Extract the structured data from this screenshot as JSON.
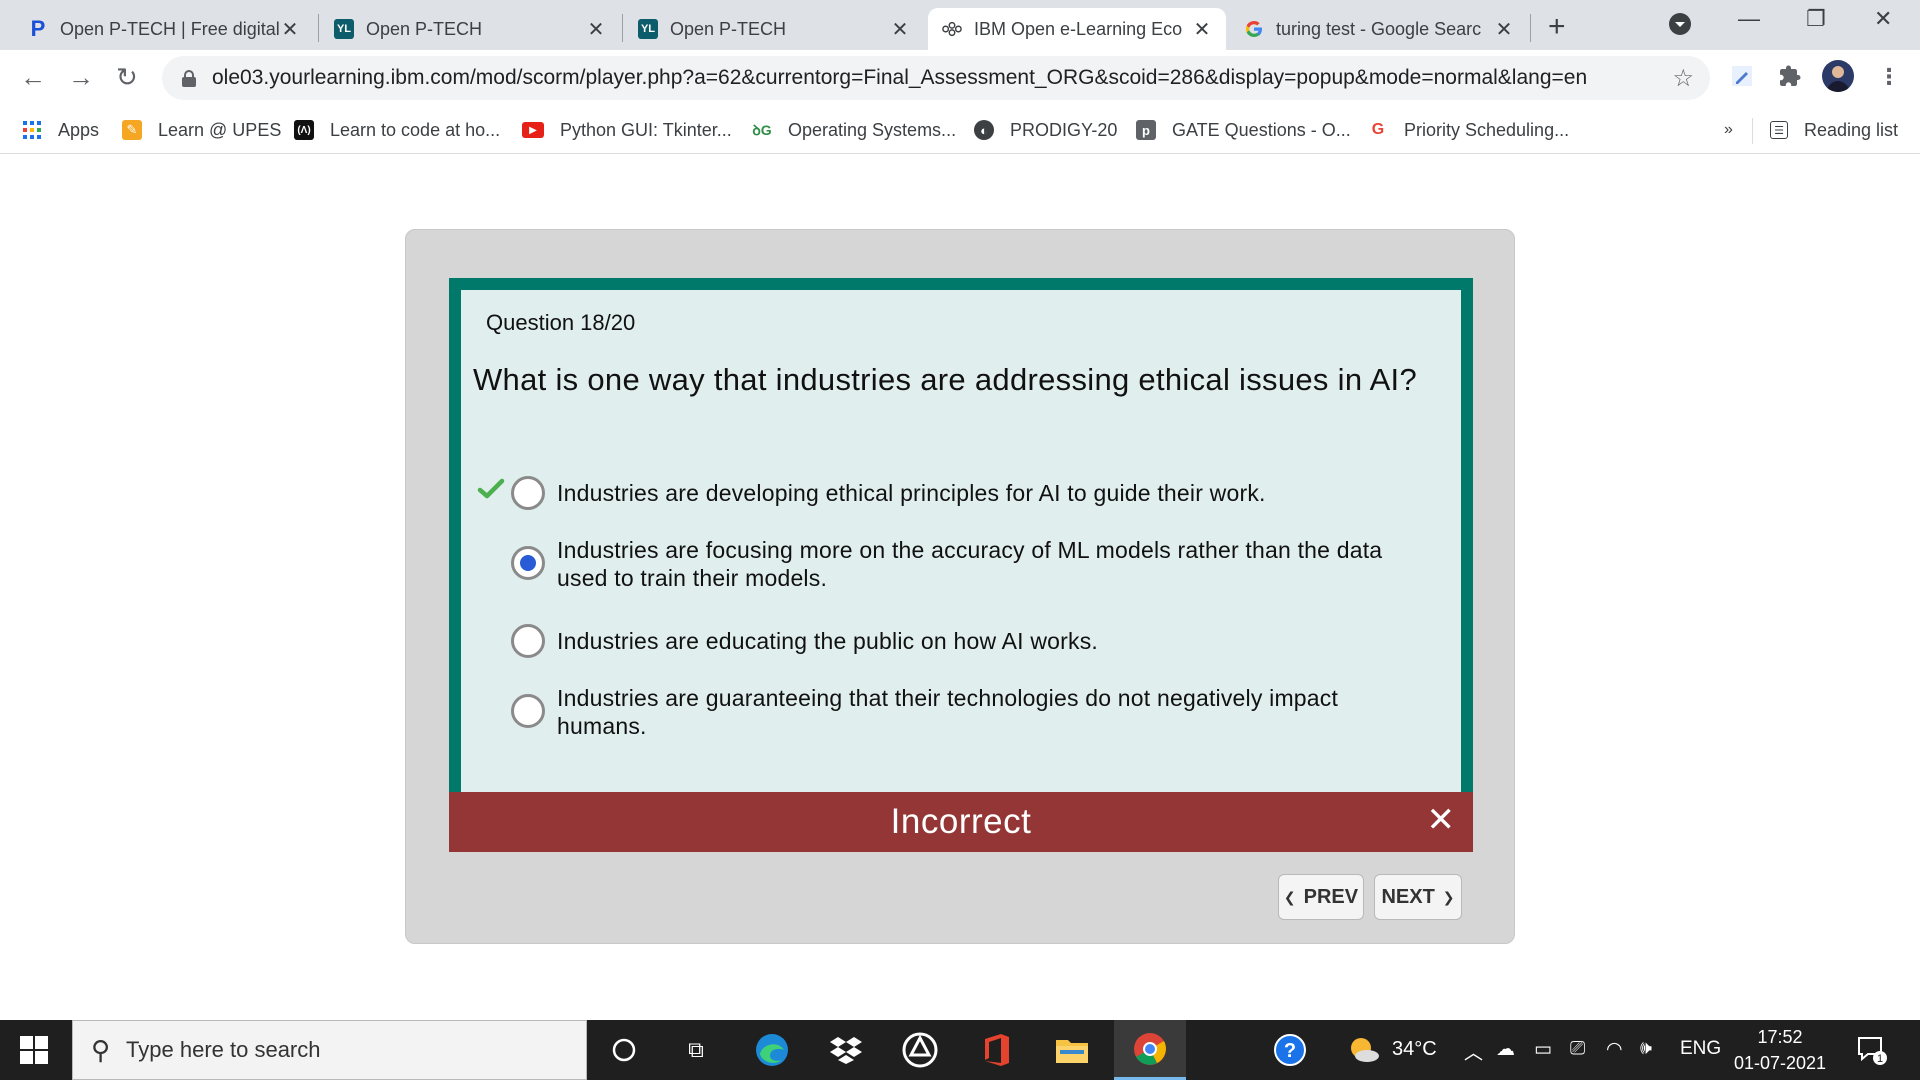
{
  "browser": {
    "tabs": [
      {
        "title": "Open P-TECH | Free digital",
        "favicon": "P",
        "favicon_color": "#1a4fd6",
        "active": false
      },
      {
        "title": "Open P-TECH",
        "favicon": "YL",
        "favicon_color": "#0d5c6b",
        "active": false
      },
      {
        "title": "Open P-TECH",
        "favicon": "YL",
        "favicon_color": "#0d5c6b",
        "active": false
      },
      {
        "title": "IBM Open e-Learning Eco",
        "favicon": "ibm-network-icon",
        "active": true
      },
      {
        "title": "turing test - Google Searc",
        "favicon": "G",
        "active": false
      }
    ],
    "url": "ole03.yourlearning.ibm.com/mod/scorm/player.php?a=62&currentorg=Final_Assessment_ORG&scoid=286&display=popup&mode=normal&lang=en",
    "bookmarks": [
      {
        "label": "Apps",
        "icon": "apps-grid-icon"
      },
      {
        "label": "Learn @ UPES",
        "icon": "pencil-icon"
      },
      {
        "label": "Learn to code at ho...",
        "icon": "code-icon"
      },
      {
        "label": "Python GUI: Tkinter...",
        "icon": "youtube-icon"
      },
      {
        "label": "Operating Systems...",
        "icon": "gfg-icon"
      },
      {
        "label": "PRODIGY-20",
        "icon": "globe-icon"
      },
      {
        "label": "GATE Questions - O...",
        "icon": "p-icon"
      },
      {
        "label": "Priority Scheduling...",
        "icon": "g-icon"
      }
    ],
    "overflow": "»",
    "reading_list": "Reading list"
  },
  "quiz": {
    "question_number": "Question 18/20",
    "question": "What is one way that industries are addressing ethical issues in AI?",
    "options": [
      {
        "text": "Industries are developing ethical principles for AI to guide their work.",
        "selected": false,
        "correct": true
      },
      {
        "text": "Industries are focusing more on the accuracy of ML models rather than the data used to train their models.",
        "selected": true,
        "correct": false
      },
      {
        "text": "Industries are educating the public on how AI works.",
        "selected": false,
        "correct": false
      },
      {
        "text": "Industries are guaranteeing that their technologies do not negatively impact humans.",
        "selected": false,
        "correct": false
      }
    ],
    "feedback": "Incorrect",
    "prev_label": "PREV",
    "next_label": "NEXT"
  },
  "colors": {
    "card_border": "#00796b",
    "card_bg": "#e0eeee",
    "feedback_bg": "#943636",
    "selected_radio": "#2a5bd7",
    "check": "#4caf50"
  },
  "taskbar": {
    "search_placeholder": "Type here to search",
    "weather": "34°C",
    "language": "ENG",
    "time": "17:52",
    "date": "01-07-2021",
    "notifications": "1"
  }
}
